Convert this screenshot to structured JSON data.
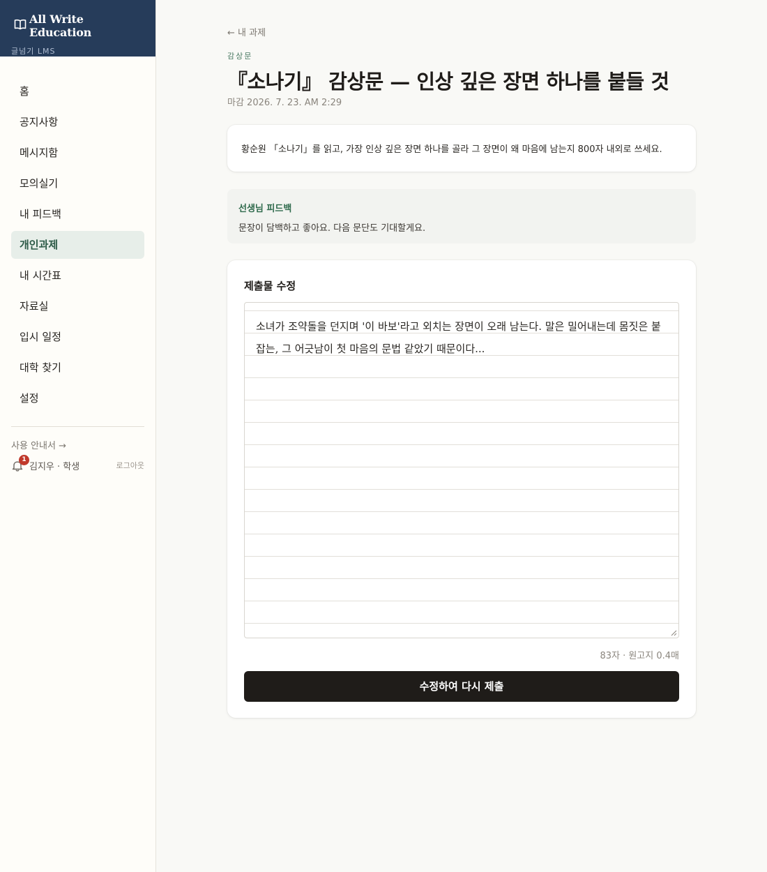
{
  "brand": {
    "title": "All Write Education",
    "subtitle": "글넘기 LMS",
    "icon": "book-open-icon",
    "color": "#263c5a"
  },
  "sidebar": {
    "items": [
      {
        "label": "홈"
      },
      {
        "label": "공지사항"
      },
      {
        "label": "메시지함"
      },
      {
        "label": "모의실기"
      },
      {
        "label": "내 피드백"
      },
      {
        "label": "개인과제",
        "active": true
      },
      {
        "label": "내 시간표"
      },
      {
        "label": "자료실"
      },
      {
        "label": "입시 일정"
      },
      {
        "label": "대학 찾기"
      },
      {
        "label": "설정"
      }
    ],
    "guide_link": "사용 안내서 →",
    "notification_count": "1",
    "user": "김지우 · 학생",
    "logout": "로그아웃"
  },
  "assignment": {
    "back_link": "← 내 과제",
    "category": "감상문",
    "title": "『소나기』 감상문 — 인상 깊은 장면 하나를 붙들 것",
    "deadline": "마감 2026. 7. 23. AM 2:29",
    "prompt": "황순원 「소나기」를 읽고, 가장 인상 깊은 장면 하나를 골라 그 장면이 왜 마음에 남는지 800자 내외로 쓰세요."
  },
  "feedback": {
    "title": "선생님 피드백",
    "text": "문장이 담백하고 좋아요. 다음 문단도 기대할게요."
  },
  "editor": {
    "title": "제출물 수정",
    "content": "소녀가 조약돌을 던지며 '이 바보'라고 외치는 장면이 오래 남는다. 말은 밀어내는데 몸짓은 붙잡는, 그 어긋남이 첫 마음의 문법 같았기 때문이다...",
    "counter": "83자 · 원고지 0.4매",
    "submit_label": "수정하여 다시 제출"
  },
  "colors": {
    "accent_green": "#2f6a4c",
    "badge_red": "#c0392b",
    "button_dark": "#1f1c19"
  }
}
